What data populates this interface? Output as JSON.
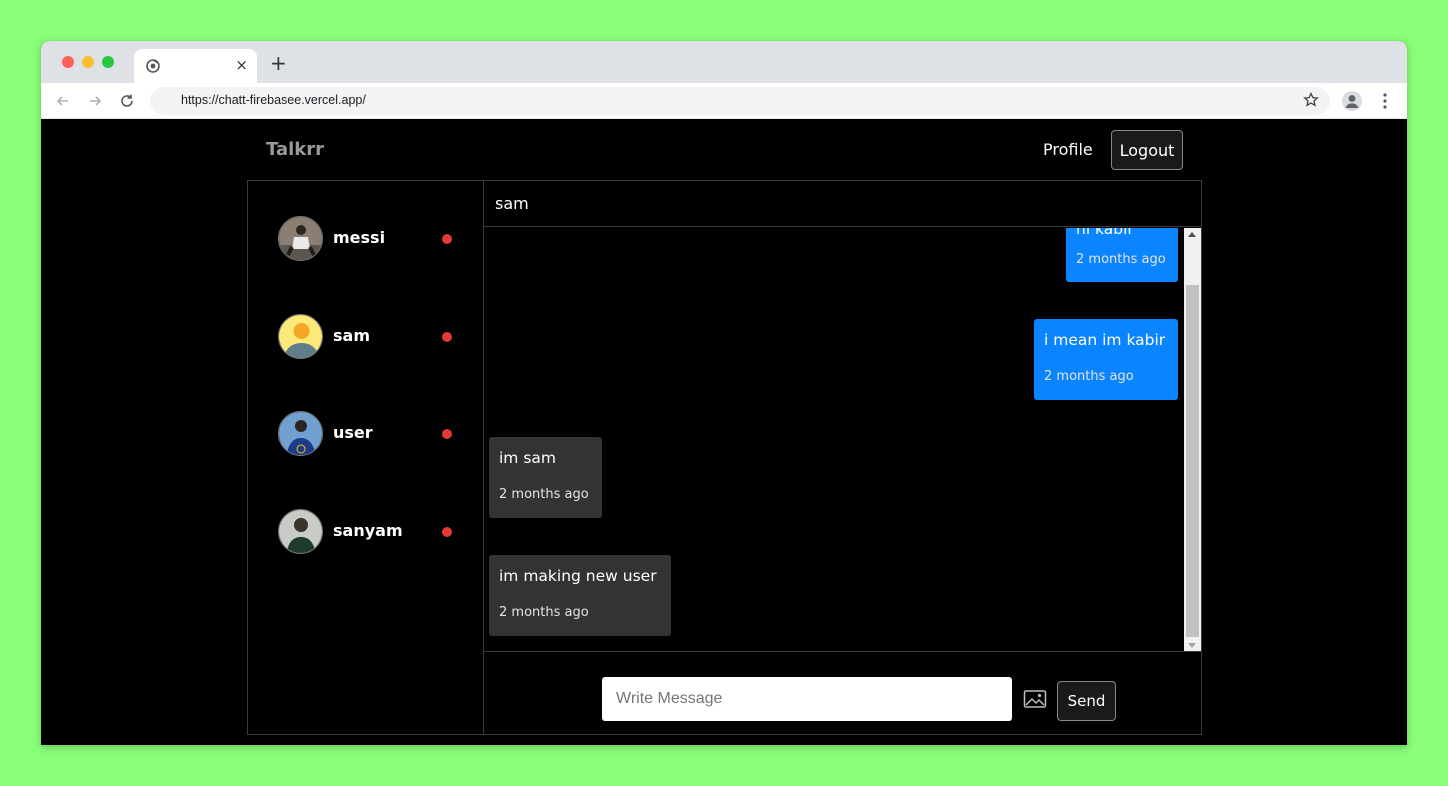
{
  "browser": {
    "url": "https://chatt-firebasee.vercel.app/",
    "tab_close": "×",
    "new_tab": "+"
  },
  "app": {
    "brand": "Talkrr",
    "nav": {
      "profile": "Profile",
      "logout": "Logout"
    }
  },
  "users": [
    {
      "name": "messi",
      "online": false,
      "avatar": "photo-seated-person"
    },
    {
      "name": "sam",
      "online": false,
      "avatar": "default-avatar"
    },
    {
      "name": "user",
      "online": false,
      "avatar": "photo-person-blue"
    },
    {
      "name": "sanyam",
      "online": false,
      "avatar": "photo-person-green"
    }
  ],
  "chat": {
    "title": "sam",
    "messages": [
      {
        "text": "hi kabir",
        "time": "2 months ago",
        "direction": "out"
      },
      {
        "text": "i mean im kabir",
        "time": "2 months ago",
        "direction": "out"
      },
      {
        "text": "im sam",
        "time": "2 months ago",
        "direction": "in"
      },
      {
        "text": "im making new user",
        "time": "2 months ago",
        "direction": "in"
      }
    ],
    "composer": {
      "placeholder": "Write Message",
      "value": "",
      "send": "Send"
    }
  },
  "colors": {
    "outgoing": "#0a84ff",
    "incoming": "#333333",
    "status_offline": "#e53935",
    "page_background": "#88ff77"
  }
}
